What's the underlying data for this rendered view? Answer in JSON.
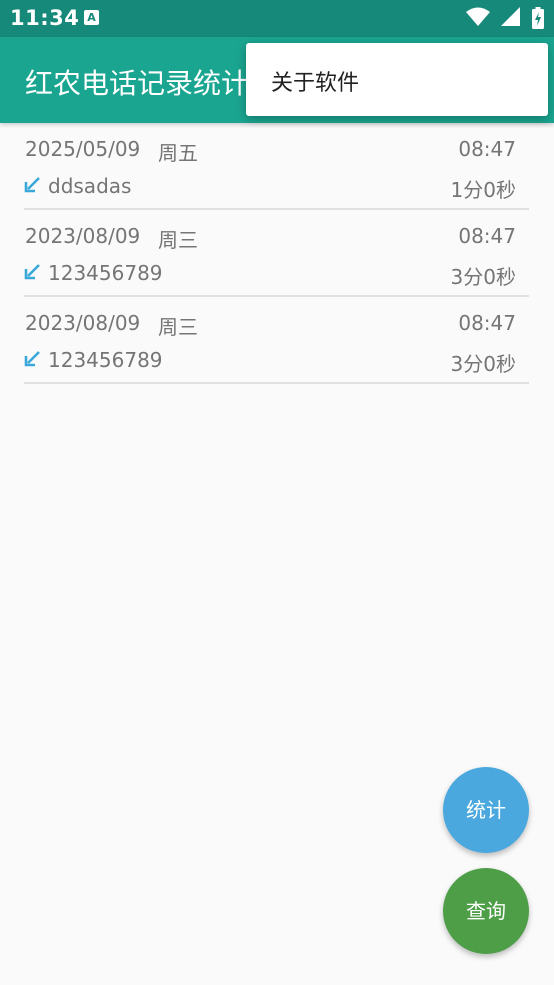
{
  "status_bar": {
    "time": "11:34",
    "notification_icon_letter": "A",
    "icons": [
      "wifi-icon",
      "signal-icon",
      "battery-charging-icon"
    ]
  },
  "app_bar": {
    "title": "红农电话记录统计"
  },
  "overflow_menu": {
    "items": [
      {
        "label": "关于软件"
      }
    ]
  },
  "calls": [
    {
      "date": "2025/05/09",
      "weekday": "周五",
      "time": "08:47",
      "number": "ddsadas",
      "duration": "1分0秒",
      "direction_icon": "incoming-call-arrow-icon"
    },
    {
      "date": "2023/08/09",
      "weekday": "周三",
      "time": "08:47",
      "number": "123456789",
      "duration": "3分0秒",
      "direction_icon": "incoming-call-arrow-icon"
    },
    {
      "date": "2023/08/09",
      "weekday": "周三",
      "time": "08:47",
      "number": "123456789",
      "duration": "3分0秒",
      "direction_icon": "incoming-call-arrow-icon"
    }
  ],
  "fabs": {
    "stats_label": "统计",
    "query_label": "查询"
  },
  "colors": {
    "status_bar": "#16897a",
    "app_bar": "#1aa590",
    "incoming_arrow": "#3aa8d8",
    "fab_stats": "#4aa8de",
    "fab_query": "#4d9e47"
  }
}
